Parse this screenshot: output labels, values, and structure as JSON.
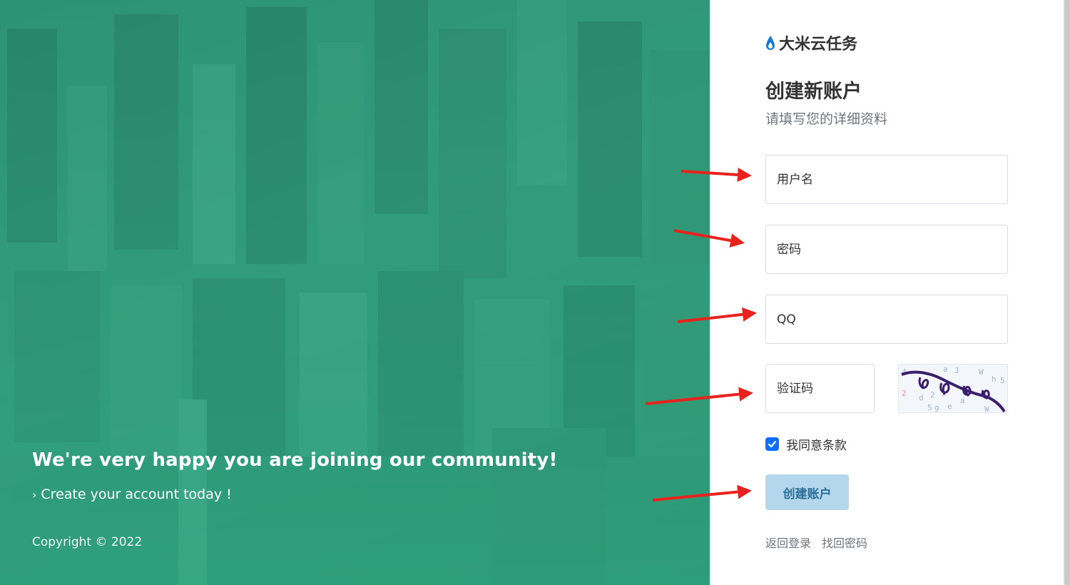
{
  "hero": {
    "heading": "We're very happy you are joining our community!",
    "subheading": "Create your account today !",
    "copyright": "Copyright © 2022"
  },
  "brand": {
    "icon": "water-drop-icon",
    "name": "大米云任务"
  },
  "form": {
    "title": "创建新账户",
    "subtitle": "请填写您的详细资料",
    "username_placeholder": "用户名",
    "password_placeholder": "密码",
    "qq_placeholder": "QQ",
    "captcha_placeholder": "验证码",
    "agree_label": "我同意条款",
    "agree_checked": true,
    "submit_label": "创建账户"
  },
  "links": {
    "back_to_login": "返回登录",
    "forgot_password": "找回密码"
  },
  "colors": {
    "hero_green": "#35a17f",
    "button_bg": "#b5d7ee",
    "button_text": "#2a6f97",
    "checkbox": "#0d6efd",
    "annotation_arrow": "#e8231d"
  }
}
